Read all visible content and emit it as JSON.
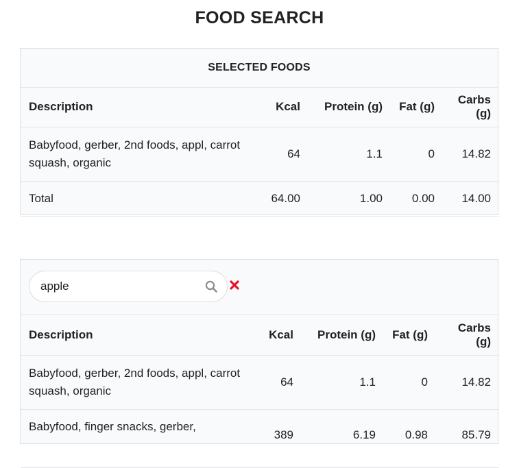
{
  "page": {
    "title": "FOOD SEARCH"
  },
  "selected": {
    "title": "SELECTED FOODS",
    "columns": [
      "Description",
      "Kcal",
      "Protein (g)",
      "Fat (g)",
      "Carbs (g)"
    ],
    "rows": [
      {
        "description": "Babyfood, gerber, 2nd foods, appl, carrot squash, organic",
        "kcal": "64",
        "protein": "1.1",
        "fat": "0",
        "carbs": "14.82"
      }
    ],
    "total": {
      "label": "Total",
      "kcal": "64.00",
      "protein": "1.00",
      "fat": "0.00",
      "carbs": "14.00"
    }
  },
  "search": {
    "value": "apple",
    "columns": [
      "Description",
      "Kcal",
      "Protein (g)",
      "Fat (g)",
      "Carbs (g)"
    ],
    "rows": [
      {
        "description": "Babyfood, gerber, 2nd foods, appl, carrot squash, organic",
        "kcal": "64",
        "protein": "1.1",
        "fat": "0",
        "carbs": "14.82"
      },
      {
        "description": "Babyfood, finger snacks, gerber,",
        "kcal": "389",
        "protein": "6.19",
        "fat": "0.98",
        "carbs": "85.79"
      }
    ]
  },
  "icons": {
    "search": "search-icon",
    "clear": "close-icon"
  },
  "colors": {
    "clear": "#e8112d",
    "border": "#dcdfe2",
    "card_bg": "#f9fafb"
  }
}
